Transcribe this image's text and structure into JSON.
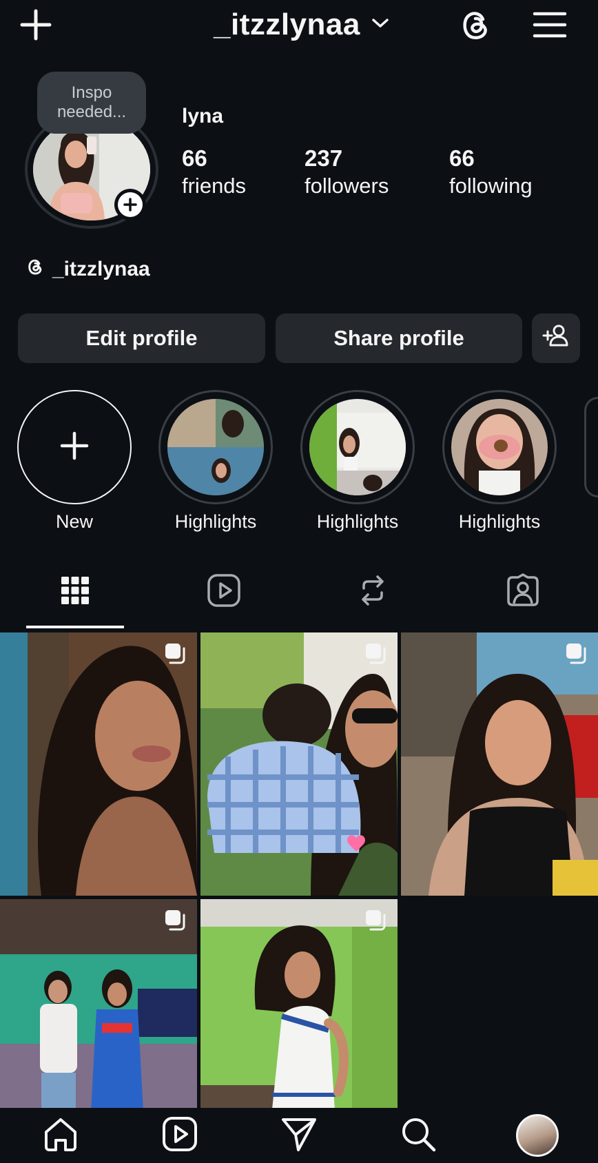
{
  "header": {
    "username": "_itzzlynaa"
  },
  "profile": {
    "note": [
      "Inspo",
      "needed..."
    ],
    "display_name": "lyna",
    "stats": [
      {
        "count": "66",
        "label": "friends"
      },
      {
        "count": "237",
        "label": "followers"
      },
      {
        "count": "66",
        "label": "following"
      }
    ],
    "threads_handle": "_itzzlynaa"
  },
  "buttons": {
    "edit_profile": "Edit profile",
    "share_profile": "Share profile"
  },
  "highlights": [
    {
      "label": "New"
    },
    {
      "label": "Highlights"
    },
    {
      "label": "Highlights"
    },
    {
      "label": "Highlights"
    }
  ],
  "tabs": [
    {
      "icon": "grid-icon",
      "active": true
    },
    {
      "icon": "reels-icon",
      "active": false
    },
    {
      "icon": "reposts-icon",
      "active": false
    },
    {
      "icon": "tagged-icon",
      "active": false
    }
  ],
  "posts": [
    {
      "kind": "carousel"
    },
    {
      "kind": "carousel"
    },
    {
      "kind": "carousel"
    },
    {
      "kind": "carousel"
    },
    {
      "kind": "carousel"
    }
  ],
  "bottom_nav": [
    {
      "icon": "home-icon"
    },
    {
      "icon": "reels-icon"
    },
    {
      "icon": "send-icon"
    },
    {
      "icon": "search-icon"
    },
    {
      "icon": "profile-avatar"
    }
  ],
  "colors": {
    "background": "#0c1014",
    "button": "#25292e",
    "text": "#f5f5f5"
  }
}
